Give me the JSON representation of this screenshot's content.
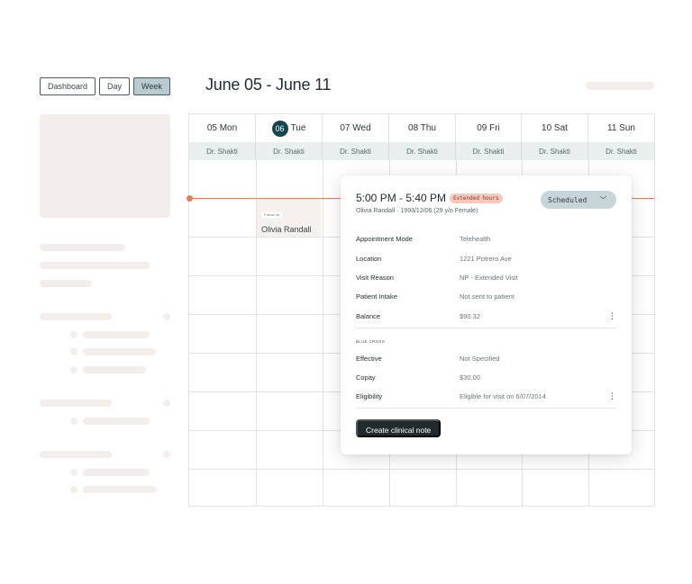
{
  "views": [
    {
      "label": "Dashboard"
    },
    {
      "label": "Day"
    },
    {
      "label": "Week"
    }
  ],
  "range_title": "June 05 - June 11",
  "days": [
    {
      "num": "",
      "label": "05 Mon",
      "provider": "Dr. Shakti"
    },
    {
      "num": "06",
      "label": "Tue",
      "provider": "Dr. Shakti"
    },
    {
      "num": "",
      "label": "07 Wed",
      "provider": "Dr. Shakti"
    },
    {
      "num": "",
      "label": "08 Thu",
      "provider": "Dr. Shakti"
    },
    {
      "num": "",
      "label": "09 Fri",
      "provider": "Dr. Shakti"
    },
    {
      "num": "",
      "label": "10 Sat",
      "provider": "Dr. Shakti"
    },
    {
      "num": "",
      "label": "11 Sun",
      "provider": "Dr. Shakti"
    }
  ],
  "appointment": {
    "tag": "Follow up",
    "patient": "Olivia Randall"
  },
  "popover": {
    "time": "5:00 PM - 5:40 PM",
    "badge": "Extended hours",
    "subtitle": "Olivia Randall · 1993/12/06 (29 y/o Female)",
    "status": "Scheduled",
    "details": [
      {
        "label": "Appointment Mode",
        "value": "Telehealth"
      },
      {
        "label": "Location",
        "value": "1221 Potrero Ave"
      },
      {
        "label": "Visit Reason",
        "value": "NP - Extended Visit"
      },
      {
        "label": "Patient Intake",
        "value": "Not sent to patient"
      },
      {
        "label": "Balance",
        "value": "$90.32"
      }
    ],
    "insurance_section": "BLUE CROSS",
    "insurance": [
      {
        "label": "Effective",
        "value": "Not Specified"
      },
      {
        "label": "Copay",
        "value": "$30.00"
      },
      {
        "label": "Eligibility",
        "value": "Eligible for visit on 6/07/2014"
      }
    ],
    "action": "Create clinical note",
    "more_icon": "⋮",
    "chevron_icon": "﹀"
  }
}
